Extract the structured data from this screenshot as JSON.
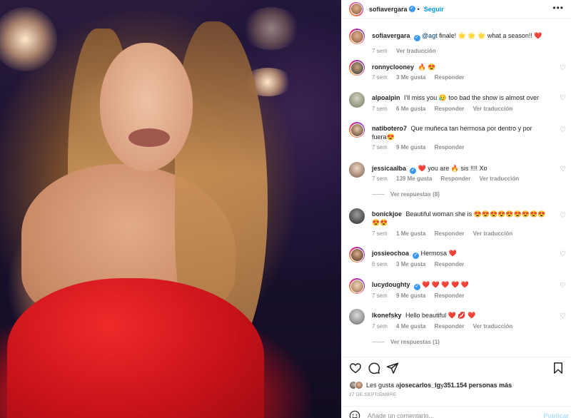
{
  "post": {
    "author": "sofiavergara",
    "follow_label": "Seguir",
    "more_label": "•••"
  },
  "caption": {
    "username": "sofiavergara",
    "mention": "@agt",
    "text": " finale! 🌟 🌟 🌟  what a season!! ❤️",
    "time": "7 sem",
    "translate": "Ver traducción"
  },
  "comments": [
    {
      "username": "ronnyclooney",
      "text": "🔥 😍",
      "time": "7 sem",
      "likes": "3 Me gusta",
      "reply": "Responder",
      "translate": ""
    },
    {
      "username": "alpoalpin",
      "text": "I'll miss you 😥 too bad the show is almost over",
      "time": "7 sem",
      "likes": "6 Me gusta",
      "reply": "Responder",
      "translate": "Ver traducción"
    },
    {
      "username": "natibotero7",
      "text": "Que muñeca tan hermosa por dentro y por fuera😍",
      "time": "7 sem",
      "likes": "9 Me gusta",
      "reply": "Responder",
      "translate": ""
    },
    {
      "username": "jessicaalba",
      "text": "❤️ you are 🔥 sis !!!! Xo",
      "time": "7 sem",
      "likes": "139 Me gusta",
      "reply": "Responder",
      "translate": "Ver traducción",
      "replies": "Ver respuestas (8)"
    },
    {
      "username": "bonickjoe",
      "text": "Beautiful woman she is 😍😍😍😍😍😍😍😍😍 😍😍",
      "time": "7 sem",
      "likes": "1 Me gusta",
      "reply": "Responder",
      "translate": "Ver traducción"
    },
    {
      "username": "jossieochoa",
      "text": "Hermosa ❤️",
      "time": "6 sem",
      "likes": "3 Me gusta",
      "reply": "Responder",
      "translate": ""
    },
    {
      "username": "lucydoughty",
      "text": "❤️ ❤️ ❤️ ❤️ ❤️",
      "time": "7 sem",
      "likes": "9 Me gusta",
      "reply": "Responder",
      "translate": ""
    },
    {
      "username": "lkonefsky",
      "text": "Hello beautiful ❤️ 💋 ❤️",
      "time": "7 sem",
      "likes": "4 Me gusta",
      "reply": "Responder",
      "translate": "Ver traducción",
      "replies": "Ver respuestas (1)"
    }
  ],
  "likes": {
    "prefix": "Les gusta a ",
    "user": "josecarlos_lg",
    "middle": " y ",
    "count": "351.154 personas más"
  },
  "date": "27 DE SEPTIEMBRE",
  "add_comment": {
    "placeholder": "Añade un comentario...",
    "publish": "Publicar"
  },
  "colors": {
    "accent": "#0095f6",
    "verified": "#3897f0",
    "heart": "#ed4956"
  }
}
